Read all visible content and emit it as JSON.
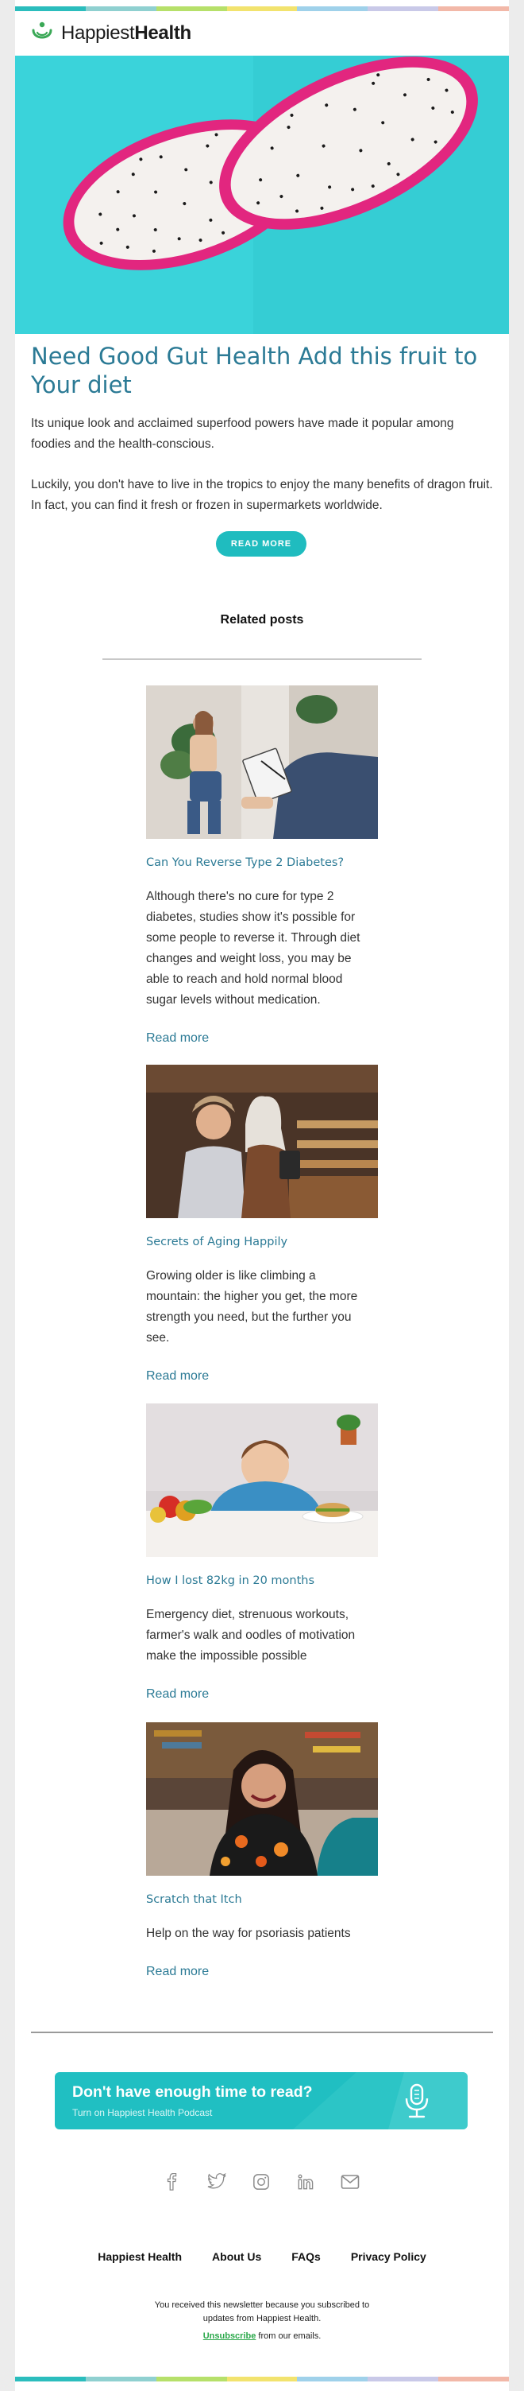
{
  "brand": {
    "name_light": "Happiest",
    "name_bold": "Health",
    "stripe_colors": [
      "#2bbdbd",
      "#8fd0d0",
      "#b6e06a",
      "#f2e36e",
      "#9fd1ea",
      "#c9c9e8",
      "#f2b8a8"
    ]
  },
  "article": {
    "title": "Need Good Gut Health Add this fruit to Your diet",
    "paragraph1": "Its unique look and acclaimed superfood powers have made it popular among foodies and the health-conscious.",
    "paragraph2": "Luckily, you don't have to live in the tropics to enjoy the many benefits of dragon fruit. In fact, you can find it fresh or frozen in supermarkets worldwide.",
    "button_label": "READ  MORE"
  },
  "related": {
    "heading": "Related posts",
    "posts": [
      {
        "title": "Can You Reverse Type 2 Diabetes?",
        "lines": [
          "Although there's no cure for type 2",
          "diabetes, studies show it's possible for",
          "some people to reverse it. Through diet",
          "changes and weight loss, you may be",
          "able to reach and hold normal blood",
          "sugar levels without medication."
        ],
        "link": "Read more"
      },
      {
        "title": "Secrets of Aging Happily",
        "lines": [
          "Growing older is like climbing a",
          "mountain: the higher you get, the more",
          "strength you need, but the further you",
          "see."
        ],
        "link": "Read more"
      },
      {
        "title": "How I lost 82kg in 20 months",
        "lines": [
          "Emergency diet, strenuous workouts,",
          "farmer's walk and oodles of motivation",
          "make the impossible possible"
        ],
        "link": "Read more"
      },
      {
        "title": "Scratch that Itch",
        "lines": [
          "Help on the way for psoriasis patients"
        ],
        "link": "Read more"
      }
    ]
  },
  "podcast": {
    "question": "Don't have enough time to read?",
    "subtitle": "Turn on Happiest Health Podcast"
  },
  "social_icons": [
    "facebook-icon",
    "twitter-icon",
    "instagram-icon",
    "linkedin-icon",
    "mail-icon"
  ],
  "footer": {
    "links": [
      "Happiest Health",
      "About Us",
      "FAQs",
      "Privacy Policy"
    ],
    "notice_line1": "You received this newsletter because you subscribed to",
    "notice_line2": "updates from Happiest Health.",
    "unsubscribe": "Unsubscribe",
    "notice_tail": " from our emails."
  }
}
